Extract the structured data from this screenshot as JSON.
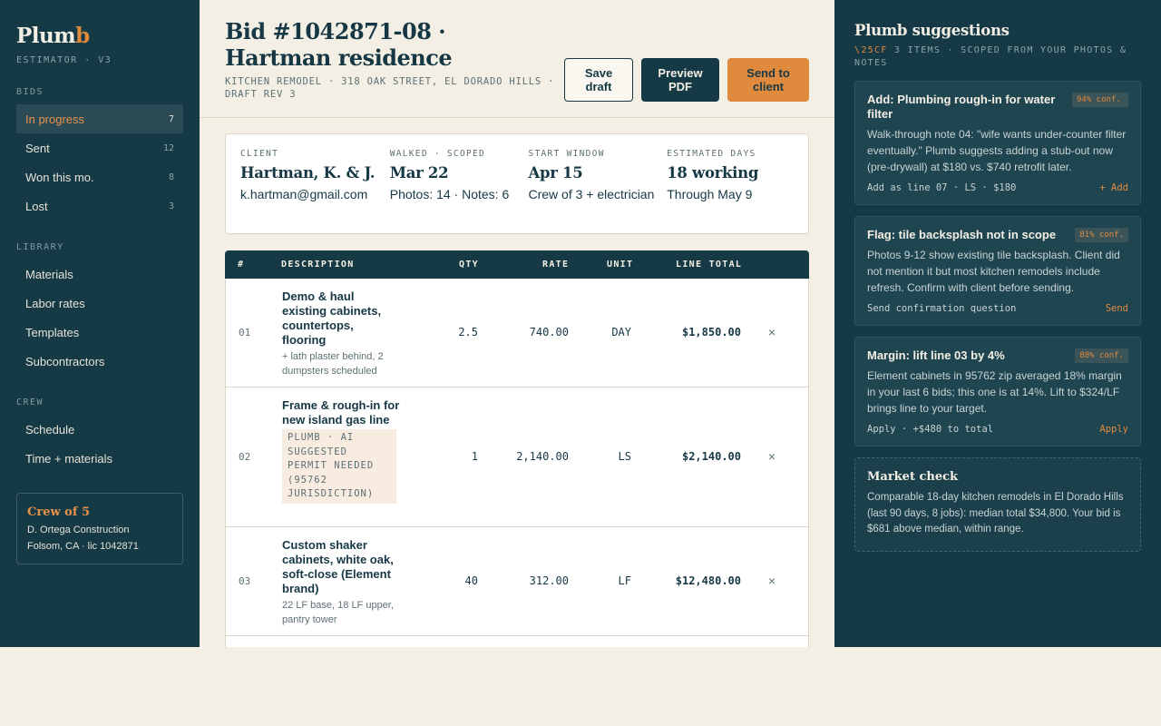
{
  "brand": {
    "name_main": "Plum",
    "name_accent": "b",
    "subtitle": "ESTIMATOR · V3"
  },
  "sidebar": {
    "sections": [
      {
        "label": "BIDS",
        "items": [
          {
            "label": "In progress",
            "count": "7",
            "active": true
          },
          {
            "label": "Sent",
            "count": "12"
          },
          {
            "label": "Won this mo.",
            "count": "8"
          },
          {
            "label": "Lost",
            "count": "3"
          }
        ]
      },
      {
        "label": "LIBRARY",
        "items": [
          {
            "label": "Materials"
          },
          {
            "label": "Labor rates"
          },
          {
            "label": "Templates"
          },
          {
            "label": "Subcontractors"
          }
        ]
      },
      {
        "label": "CREW",
        "items": [
          {
            "label": "Schedule"
          },
          {
            "label": "Time + materials"
          }
        ]
      }
    ],
    "crew_card": {
      "title": "Crew of 5",
      "company": "D. Ortega Construction",
      "location": "Folsom, CA · lic 1042871"
    }
  },
  "header": {
    "title": "Bid #1042871-08 · Hartman residence",
    "subtitle": "KITCHEN REMODEL · 318 OAK STREET, EL DORADO HILLS · DRAFT REV 3",
    "buttons": {
      "save": "Save draft",
      "preview": "Preview PDF",
      "send": "Send to client"
    }
  },
  "info": {
    "client": {
      "label": "CLIENT",
      "value": "Hartman, K. & J.",
      "sub": "k.hartman@gmail.com"
    },
    "walked": {
      "label": "WALKED · SCOPED",
      "value": "Mar 22",
      "sub": "Photos: 14 · Notes: 6"
    },
    "start": {
      "label": "START WINDOW",
      "value": "Apr 15",
      "sub": "Crew of 3 + electrician"
    },
    "days": {
      "label": "ESTIMATED DAYS",
      "value": "18 working",
      "sub": "Through May 9"
    }
  },
  "table": {
    "headers": {
      "num": "#",
      "desc": "DESCRIPTION",
      "qty": "QTY",
      "rate": "RATE",
      "unit": "UNIT",
      "total": "LINE TOTAL"
    },
    "rows": [
      {
        "num": "01",
        "desc": "Demo & haul existing cabinets, countertops, flooring",
        "note": "+ lath plaster behind, 2 dumpsters scheduled",
        "qty": "2.5",
        "rate": "740.00",
        "unit": "DAY",
        "total": "$1,850.00",
        "remove": "×"
      },
      {
        "num": "02",
        "desc": "Frame & rough-in for new island gas line",
        "ai_tag": "PLUMB · AI SUGGESTED PERMIT NEEDED (95762 JURISDICTION)",
        "qty": "1",
        "rate": "2,140.00",
        "unit": "LS",
        "total": "$2,140.00",
        "remove": "×"
      },
      {
        "num": "03",
        "desc": "Custom shaker cabinets, white oak, soft-close (Element brand)",
        "note": "22 LF base, 18 LF upper, pantry tower",
        "qty": "40",
        "rate": "312.00",
        "unit": "LF",
        "total": "$12,480.00",
        "remove": "×"
      }
    ]
  },
  "suggestions": {
    "title": "Plumb suggestions",
    "sub_code": "\\25CF",
    "sub_text": " 3 ITEMS · SCOPED FROM YOUR PHOTOS & NOTES",
    "items": [
      {
        "title": "Add: Plumbing rough-in for water filter",
        "conf": "94% conf.",
        "body": "Walk-through note 04: \"wife wants under-counter filter eventually.\" Plumb suggests adding a stub-out now (pre-drywall) at $180 vs. $740 retrofit later.",
        "foot": "Add as line 07 · LS · $180",
        "action": "+ Add"
      },
      {
        "title": "Flag: tile backsplash not in scope",
        "conf": "81% conf.",
        "body": "Photos 9-12 show existing tile backsplash. Client did not mention it but most kitchen remodels include refresh. Confirm with client before sending.",
        "foot": "Send confirmation question",
        "action": "Send"
      },
      {
        "title": "Margin: lift line 03 by 4%",
        "conf": "88% conf.",
        "body": "Element cabinets in 95762 zip averaged 18% margin in your last 6 bids; this one is at 14%. Lift to $324/LF brings line to your target.",
        "foot": "Apply · +$480 to total",
        "action": "Apply"
      }
    ],
    "market": {
      "title": "Market check",
      "body": "Comparable 18-day kitchen remodels in El Dorado Hills (last 90 days, 8 jobs): median total $34,800. Your bid is $681 above median, within range."
    }
  },
  "colors": {
    "navy": "#163a45",
    "cream": "#f4efe4",
    "accent": "#e08a3e"
  }
}
